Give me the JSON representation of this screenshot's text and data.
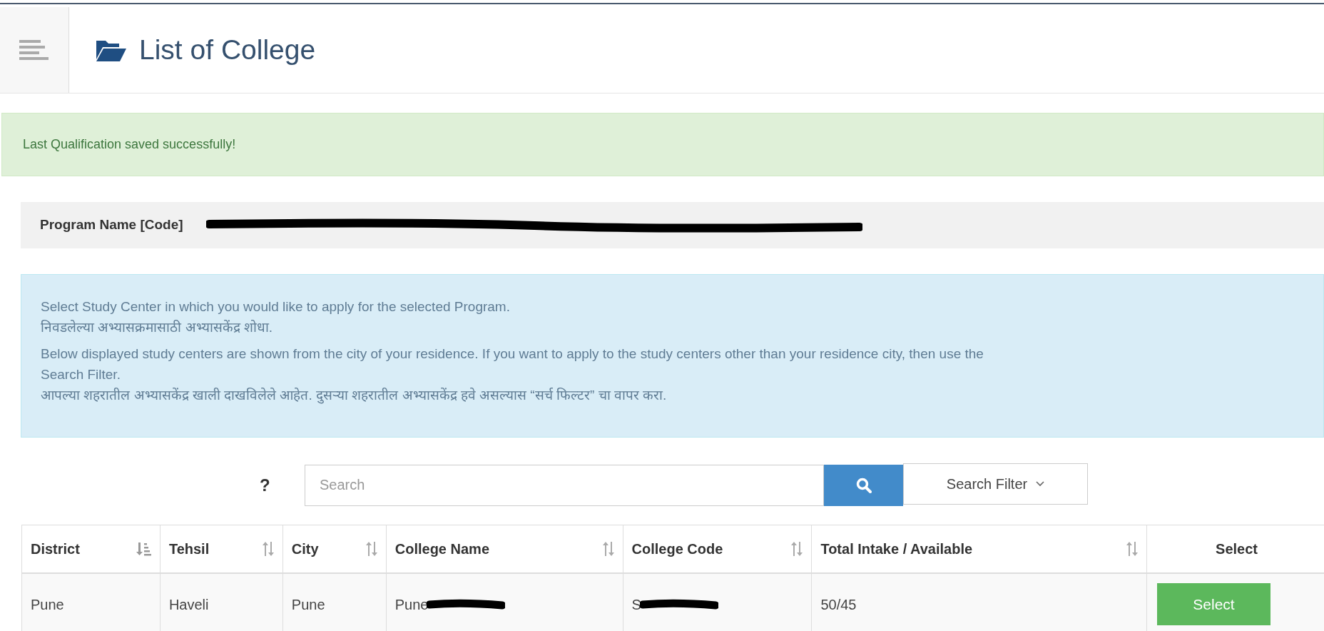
{
  "header": {
    "title": "List of College"
  },
  "alert": {
    "message": "Last Qualification saved successfully!"
  },
  "program": {
    "label": "Program Name [Code]",
    "value_redacted": true
  },
  "info": {
    "paragraphs": [
      [
        "Select Study Center in which you would like to apply for the selected Program.",
        "निवडलेल्या अभ्यासक्रमासाठी अभ्यासकेंद्र शोधा."
      ],
      [
        "Below displayed study centers are shown from the city of your residence. If you want to apply to the study centers other than your residence city, then use the Search Filter.",
        "आपल्या शहरातील अभ्यासकेंद्र खाली दाखविलेले आहेत. दुसऱ्या शहरातील अभ्यासकेंद्र हवे असल्यास “सर्च फिल्टर” चा वापर करा."
      ]
    ]
  },
  "search": {
    "help": "?",
    "placeholder": "Search",
    "filter_label": "Search Filter"
  },
  "table": {
    "columns": [
      {
        "label": "District",
        "kind": "sorted"
      },
      {
        "label": "Tehsil",
        "kind": "sortable"
      },
      {
        "label": "City",
        "kind": "sortable"
      },
      {
        "label": "College Name",
        "kind": "sortable"
      },
      {
        "label": "College Code",
        "kind": "sortable"
      },
      {
        "label": "Total Intake / Available",
        "kind": "sortable"
      },
      {
        "label": "Select",
        "kind": "plain"
      }
    ],
    "rows": [
      {
        "cells": [
          {
            "text": "Pune",
            "redacted": false
          },
          {
            "text": "Haveli",
            "redacted": false
          },
          {
            "text": "Pune",
            "redacted": false
          },
          {
            "text": "Pune",
            "redacted": true
          },
          {
            "text": "S",
            "redacted": true
          },
          {
            "text": "50/45",
            "redacted": false
          }
        ],
        "action": "Select"
      }
    ]
  }
}
